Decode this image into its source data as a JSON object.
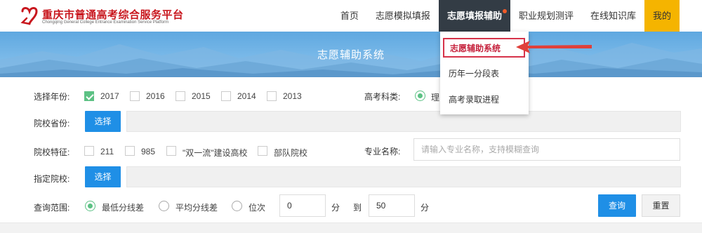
{
  "header": {
    "logo_title": "重庆市普通高考综合服务平台",
    "logo_subtitle": "Chongqing General College Entrance Examination Service Platform",
    "brand_color": "#c8161d"
  },
  "nav": {
    "items": [
      {
        "label": "首页"
      },
      {
        "label": "志愿模拟填报"
      },
      {
        "label": "志愿填报辅助"
      },
      {
        "label": "职业规划测评"
      },
      {
        "label": "在线知识库"
      },
      {
        "label": "我的"
      }
    ],
    "active_color": "#333c45",
    "mine_color": "#f5b400"
  },
  "banner": {
    "title": "志愿辅助系统"
  },
  "dropdown": {
    "items": [
      {
        "label": "志愿辅助系统"
      },
      {
        "label": "历年一分段表"
      },
      {
        "label": "高考录取进程"
      }
    ],
    "highlight_color": "#d6334a"
  },
  "form": {
    "year_label": "选择年份:",
    "years": [
      {
        "label": "2017",
        "checked": true
      },
      {
        "label": "2016",
        "checked": false
      },
      {
        "label": "2015",
        "checked": false
      },
      {
        "label": "2014",
        "checked": false
      },
      {
        "label": "2013",
        "checked": false
      }
    ],
    "subject_label": "高考科类:",
    "subject_option": "理",
    "province_label": "院校省份:",
    "select_button": "选择",
    "feature_label": "院校特征:",
    "features": [
      {
        "label": "211",
        "checked": false
      },
      {
        "label": "985",
        "checked": false
      },
      {
        "label": "\"双一流\"建设高校",
        "checked": false
      },
      {
        "label": "部队院校",
        "checked": false
      }
    ],
    "major_label": "专业名称:",
    "major_placeholder": "请输入专业名称，支持模糊查询",
    "school_label": "指定院校:",
    "range_label": "查询范围:",
    "range_options": [
      {
        "label": "最低分线差",
        "checked": true
      },
      {
        "label": "平均分线差",
        "checked": false
      },
      {
        "label": "位次",
        "checked": false
      }
    ],
    "from_value": "0",
    "unit_1": "分",
    "to_label": "到",
    "to_value": "50",
    "unit_2": "分",
    "query_button": "查询",
    "reset_button": "重置",
    "accent_color": "#1f8fe6",
    "check_color": "#5cc184"
  }
}
